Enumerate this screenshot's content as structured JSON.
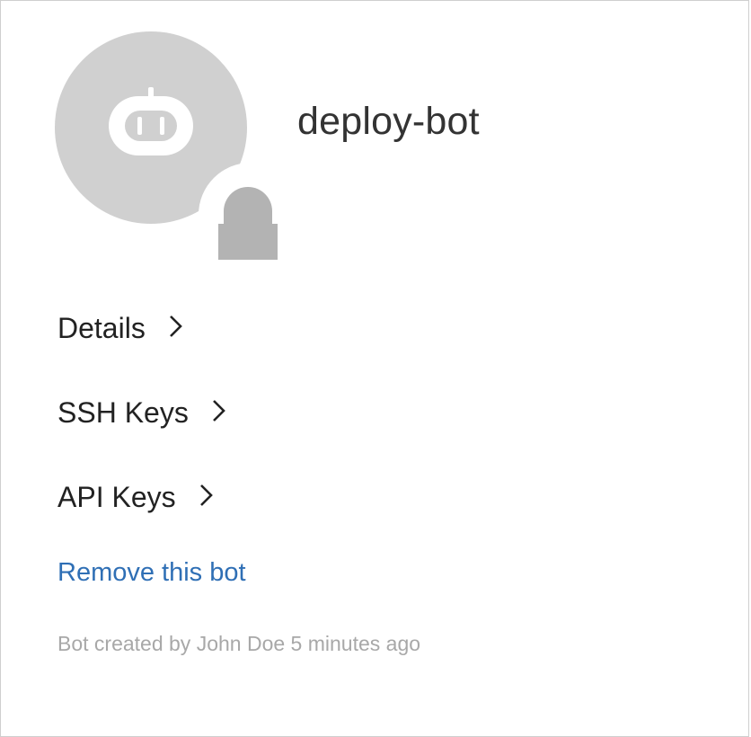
{
  "bot": {
    "name": "deploy-bot",
    "avatar_icon": "bot-face-icon",
    "badge_icon": "lock-icon"
  },
  "nav": {
    "items": [
      {
        "label": "Details",
        "icon": "chevron-right-icon"
      },
      {
        "label": "SSH Keys",
        "icon": "chevron-right-icon"
      },
      {
        "label": "API Keys",
        "icon": "chevron-right-icon"
      }
    ]
  },
  "actions": {
    "remove_label": "Remove this bot"
  },
  "meta": {
    "created_text": "Bot created by John Doe 5 minutes ago"
  },
  "colors": {
    "avatar_bg": "#d0d0d0",
    "lock": "#b3b3b3",
    "link": "#2f6fb5",
    "meta_text": "#a8a8a8"
  }
}
